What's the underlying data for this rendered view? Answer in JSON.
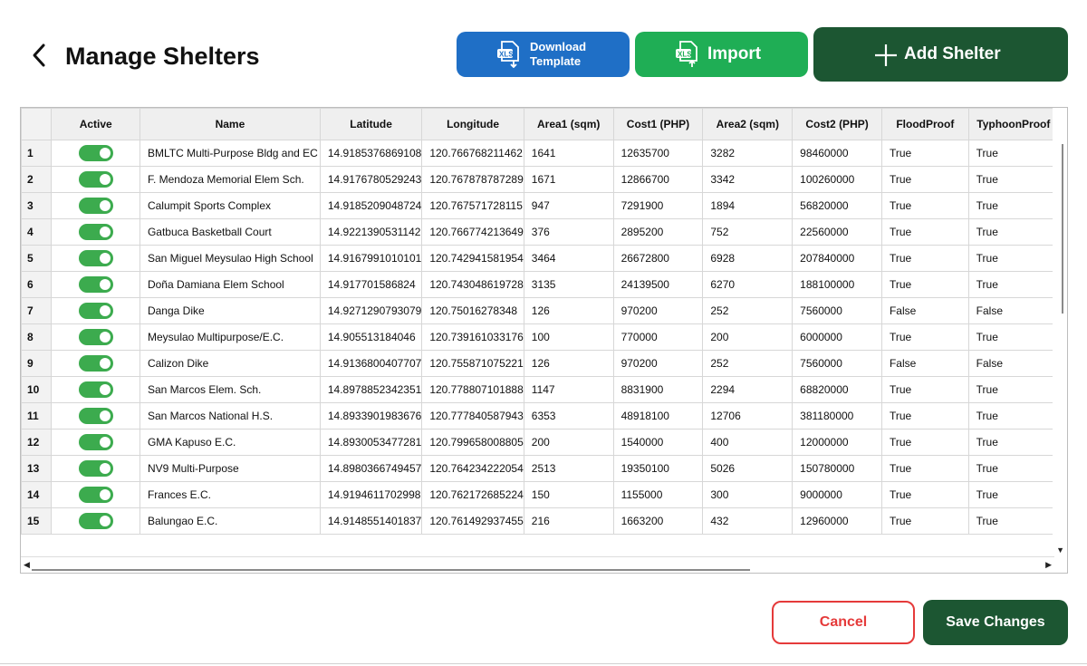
{
  "header": {
    "title": "Manage Shelters"
  },
  "toolbar": {
    "download_line1": "Download",
    "download_line2": "Template",
    "import_label": "Import",
    "add_label": "Add Shelter",
    "xls_badge": "XLS"
  },
  "table": {
    "columns": [
      "Active",
      "Name",
      "Latitude",
      "Longitude",
      "Area1 (sqm)",
      "Cost1 (PHP)",
      "Area2 (sqm)",
      "Cost2 (PHP)",
      "FloodProof",
      "TyphoonProof"
    ],
    "rows": [
      {
        "n": "1",
        "active": true,
        "name": "BMLTC Multi-Purpose Bldg and EC",
        "lat": "14.9185376869108",
        "lon": "120.766768211462",
        "area1": "1641",
        "cost1": "12635700",
        "area2": "3282",
        "cost2": "98460000",
        "flood": "True",
        "typhoon": "True"
      },
      {
        "n": "2",
        "active": true,
        "name": "F. Mendoza Memorial Elem Sch.",
        "lat": "14.9176780529243",
        "lon": "120.767878787289",
        "area1": "1671",
        "cost1": "12866700",
        "area2": "3342",
        "cost2": "100260000",
        "flood": "True",
        "typhoon": "True"
      },
      {
        "n": "3",
        "active": true,
        "name": "Calumpit Sports Complex",
        "lat": "14.9185209048724",
        "lon": "120.767571728115",
        "area1": "947",
        "cost1": "7291900",
        "area2": "1894",
        "cost2": "56820000",
        "flood": "True",
        "typhoon": "True"
      },
      {
        "n": "4",
        "active": true,
        "name": "Gatbuca Basketball Court",
        "lat": "14.9221390531142",
        "lon": "120.766774213649",
        "area1": "376",
        "cost1": "2895200",
        "area2": "752",
        "cost2": "22560000",
        "flood": "True",
        "typhoon": "True"
      },
      {
        "n": "5",
        "active": true,
        "name": "San Miguel Meysulao High School",
        "lat": "14.9167991010101",
        "lon": "120.742941581954",
        "area1": "3464",
        "cost1": "26672800",
        "area2": "6928",
        "cost2": "207840000",
        "flood": "True",
        "typhoon": "True"
      },
      {
        "n": "6",
        "active": true,
        "name": "Doña Damiana Elem School",
        "lat": "14.917701586824",
        "lon": "120.743048619728",
        "area1": "3135",
        "cost1": "24139500",
        "area2": "6270",
        "cost2": "188100000",
        "flood": "True",
        "typhoon": "True"
      },
      {
        "n": "7",
        "active": true,
        "name": "Danga Dike",
        "lat": "14.9271290793079",
        "lon": "120.75016278348",
        "area1": "126",
        "cost1": "970200",
        "area2": "252",
        "cost2": "7560000",
        "flood": "False",
        "typhoon": "False"
      },
      {
        "n": "8",
        "active": true,
        "name": "Meysulao Multipurpose/E.C.",
        "lat": "14.905513184046",
        "lon": "120.739161033176",
        "area1": "100",
        "cost1": "770000",
        "area2": "200",
        "cost2": "6000000",
        "flood": "True",
        "typhoon": "True"
      },
      {
        "n": "9",
        "active": true,
        "name": "Calizon Dike",
        "lat": "14.9136800407707",
        "lon": "120.755871075221",
        "area1": "126",
        "cost1": "970200",
        "area2": "252",
        "cost2": "7560000",
        "flood": "False",
        "typhoon": "False"
      },
      {
        "n": "10",
        "active": true,
        "name": "San Marcos Elem. Sch.",
        "lat": "14.8978852342351",
        "lon": "120.778807101888",
        "area1": "1147",
        "cost1": "8831900",
        "area2": "2294",
        "cost2": "68820000",
        "flood": "True",
        "typhoon": "True"
      },
      {
        "n": "11",
        "active": true,
        "name": "San Marcos National H.S.",
        "lat": "14.8933901983676",
        "lon": "120.777840587943",
        "area1": "6353",
        "cost1": "48918100",
        "area2": "12706",
        "cost2": "381180000",
        "flood": "True",
        "typhoon": "True"
      },
      {
        "n": "12",
        "active": true,
        "name": "GMA Kapuso E.C.",
        "lat": "14.8930053477281",
        "lon": "120.799658008805",
        "area1": "200",
        "cost1": "1540000",
        "area2": "400",
        "cost2": "12000000",
        "flood": "True",
        "typhoon": "True"
      },
      {
        "n": "13",
        "active": true,
        "name": "NV9 Multi-Purpose",
        "lat": "14.8980366749457",
        "lon": "120.764234222054",
        "area1": "2513",
        "cost1": "19350100",
        "area2": "5026",
        "cost2": "150780000",
        "flood": "True",
        "typhoon": "True"
      },
      {
        "n": "14",
        "active": true,
        "name": "Frances E.C.",
        "lat": "14.9194611702998",
        "lon": "120.762172685224",
        "area1": "150",
        "cost1": "1155000",
        "area2": "300",
        "cost2": "9000000",
        "flood": "True",
        "typhoon": "True"
      },
      {
        "n": "15",
        "active": true,
        "name": "Balungao E.C.",
        "lat": "14.9148551401837",
        "lon": "120.761492937455",
        "area1": "216",
        "cost1": "1663200",
        "area2": "432",
        "cost2": "12960000",
        "flood": "True",
        "typhoon": "True"
      }
    ]
  },
  "footer": {
    "cancel_label": "Cancel",
    "save_label": "Save Changes"
  },
  "colors": {
    "download": "#1f6fc6",
    "import": "#1fae55",
    "primary": "#1c5632",
    "danger": "#e53a3a",
    "toggle_on": "#3cab4e"
  }
}
